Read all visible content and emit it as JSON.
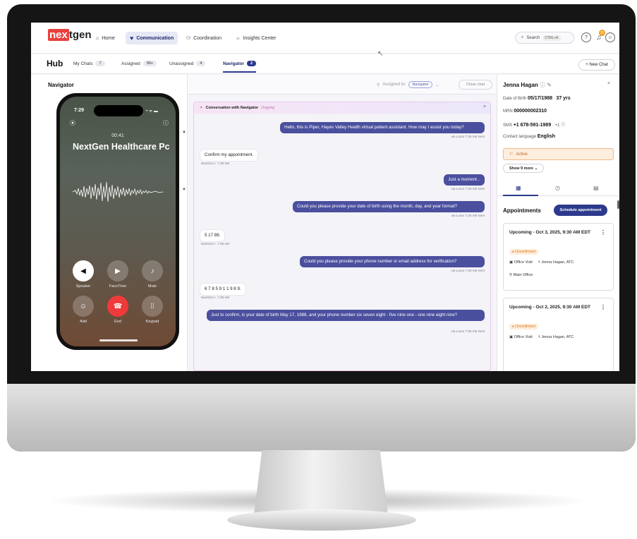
{
  "topbar": {
    "brand": "nextgen",
    "nav": [
      {
        "label": "Home",
        "icon": "home-icon"
      },
      {
        "label": "Communication",
        "icon": "heart-icon"
      },
      {
        "label": "Coordination",
        "icon": "network-icon"
      },
      {
        "label": "Insights Center",
        "icon": "lightbulb-icon"
      }
    ],
    "search_label": "Search",
    "search_shortcut": "CTRL+K",
    "notification_count": "20"
  },
  "hub": {
    "title": "Hub",
    "tabs": [
      {
        "label": "My Chats",
        "count": "7"
      },
      {
        "label": "Assigned",
        "count": "99+"
      },
      {
        "label": "Unassigned",
        "count": "4"
      },
      {
        "label": "Navigator",
        "count": "2"
      }
    ],
    "new_chat": "+ New Chat"
  },
  "left_panel": {
    "title": "Navigator"
  },
  "phone": {
    "time": "7:29",
    "timer": "00:41",
    "caller": "NextGen Healthcare Pc",
    "buttons": [
      "Speaker",
      "FaceTime",
      "Mute",
      "Add",
      "End",
      "Keypad"
    ]
  },
  "chat": {
    "assigned_to_label": "Assigned to:",
    "assigned_to_value": "Navigator",
    "close_chat": "Close chat",
    "header_title": "Conversation with Navigator",
    "header_status": "Ongoing",
    "messages": [
      {
        "dir": "out",
        "text": "Hello, this is Piper, Hayes Valley Health virtual patient assistant. How may I assist you today?",
        "meta": "via Lumo 7:29 AM Sent"
      },
      {
        "dir": "in",
        "text": "Confirm my appointment.",
        "meta": "NextGen I. 7:29 AM"
      },
      {
        "dir": "out",
        "text": "Just a moment...",
        "meta": "via Lumo 7:29 AM Sent"
      },
      {
        "dir": "out",
        "text": "Could you please provide your date of birth using the month, day, and year format?",
        "meta": "via Lumo 7:29 AM Sent"
      },
      {
        "dir": "in",
        "text": "5 17 88.",
        "meta": "NextGen I. 7:29 AM"
      },
      {
        "dir": "out",
        "text": "Could you please provide your phone number or email address for verification?",
        "meta": "via Lumo 7:29 AM Sent"
      },
      {
        "dir": "in",
        "text": "6 7 8 5 9 1 1 9 8 9.",
        "meta": "NextGen I. 7:29 AM"
      },
      {
        "dir": "out",
        "text": "Just to confirm, is your date of birth May 17, 1988, and your phone number six seven eight - five nine one - one nine eight nine?",
        "meta": "via Lumo 7:29 AM Sent"
      }
    ]
  },
  "patient": {
    "name": "Jenna Hagan",
    "dob_label": "Date of Birth",
    "dob": "05/17/1988",
    "age": "37 yrs",
    "mrn_label": "MRN",
    "mrn": "000000002310",
    "sms_label": "SMS",
    "sms": "+1 678-591-1989",
    "sms_extra": "+1",
    "language_label": "Contact language",
    "language": "English",
    "status": "Active",
    "show_more": "Show 9 more",
    "appointments_title": "Appointments",
    "schedule_button": "Schedule appointment",
    "appointments": [
      {
        "title": "Upcoming - Oct 3, 2025, 9:30 AM EDT",
        "status": "Unconfirmed",
        "type": "Office Visit",
        "provider": "Jenna Hagan, ATC",
        "location": "Main Office"
      },
      {
        "title": "Upcoming - Oct 2, 2025, 9:30 AM EDT",
        "status": "Unconfirmed",
        "type": "Office Visit",
        "provider": "Jenna Hagan, ATC"
      }
    ]
  },
  "colors": {
    "brand_red": "#e8403c",
    "primary": "#2b3a8c",
    "outgoing_bubble": "#4a4f9e",
    "end_call": "#ee3a3a",
    "active_status": "#c0662a"
  }
}
